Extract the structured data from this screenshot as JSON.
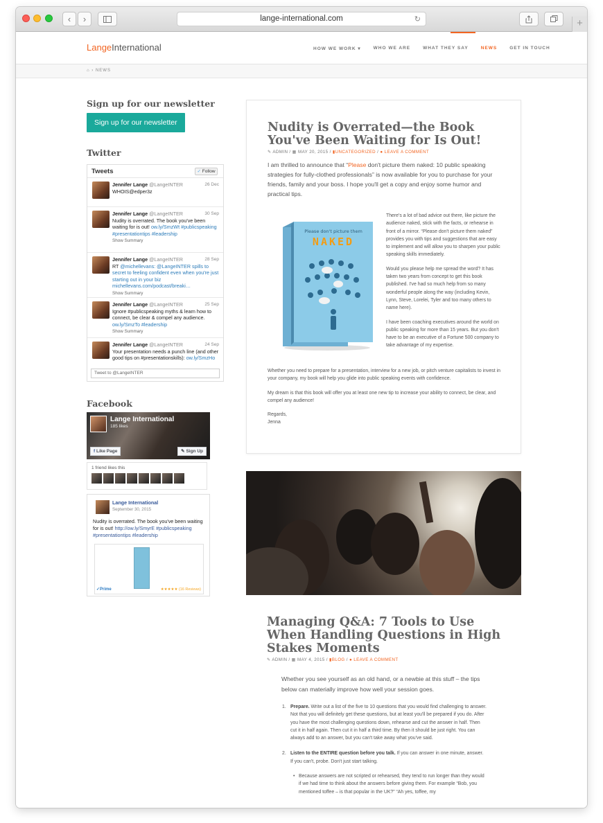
{
  "browser": {
    "url": "lange-international.com",
    "back": "‹",
    "forward": "›",
    "reload": "↻",
    "new_tab": "+"
  },
  "nav": {
    "logo_a": "Lange",
    "logo_b": "International",
    "items": [
      {
        "label": "HOW WE WORK ▾"
      },
      {
        "label": "WHO WE ARE"
      },
      {
        "label": "WHAT THEY SAY"
      },
      {
        "label": "NEWS"
      },
      {
        "label": "GET IN TOUCH"
      }
    ]
  },
  "breadcrumb": {
    "home_icon": "⌂",
    "separator": "›",
    "current": "NEWS"
  },
  "newsletter": {
    "heading": "Sign up for our newsletter",
    "button": "Sign up for our newsletter"
  },
  "twitter": {
    "heading": "Twitter",
    "tweets_label": "Tweets",
    "follow": "Follow",
    "tweets": [
      {
        "name": "Jennifer Lange",
        "handle": "@LangeINTER",
        "date": "26 Dec",
        "text": "WHOIS@edper3z",
        "summary": ""
      },
      {
        "name": "Jennifer Lange",
        "handle": "@LangeINTER",
        "date": "30 Sep",
        "text": "Nudity is overrated. The book you've been waiting for is out! ",
        "link": "ow.ly/SmzWt #publicspeaking #presentationtips #leadership",
        "summary": "Show Summary"
      },
      {
        "name": "Jennifer Lange",
        "handle": "@LangeINTER",
        "date": "28 Sep",
        "text": "RT ",
        "link": "@michellevans: @LangeINTER spills to secret to feeling confident even when you're just starting out in your biz michellevans.com/podcast/breaki…",
        "summary": "Show Summary"
      },
      {
        "name": "Jennifer Lange",
        "handle": "@LangeINTER",
        "date": "25 Sep",
        "text": "Ignore #publicspeaking myths & learn how to connect, be clear & compel any audience. ",
        "link": "ow.ly/SmzTo #leadership",
        "summary": "Show Summary"
      },
      {
        "name": "Jennifer Lange",
        "handle": "@LangeINTER",
        "date": "24 Sep",
        "text": "Your presentation needs a punch line (and other good tips on #presentationskills): ",
        "link": "ow.ly/SmzHo",
        "summary": ""
      }
    ],
    "compose_placeholder": "Tweet to @LangeINTER"
  },
  "facebook": {
    "heading": "Facebook",
    "page_name": "Lange International",
    "likes": "185 likes",
    "like_button": "Like Page",
    "signup_button": "Sign Up",
    "friends_text": "1 friend likes this",
    "post": {
      "author": "Lange International",
      "date": "September 30, 2015",
      "text": "Nudity is overrated. The book you've been waiting for is out! ",
      "link": "http://ow.ly/SmyrE #publicspeaking #presentationtips #leadership",
      "prime": "✓Prime",
      "stars": "★★★★★ (16 Reviews)"
    }
  },
  "post1": {
    "title": "Nudity is Overrated—the Book You've Been Waiting for Is Out!",
    "author": "ADMIN",
    "date": "MAY 20, 2015",
    "category": "UNCATEGORIZED",
    "comment": "LEAVE A COMMENT",
    "lead_a": "I am thrilled to announce that “",
    "lead_hl": "Please",
    "lead_b": " don't picture them naked: 10 public speaking strategies for fully-clothed professionals” is now available for you to purchase for your friends, family and your boss. I hope you'll get a copy and enjoy some humor and practical tips.",
    "book_title": "Please don't picture them",
    "book_big": "NAKED",
    "p1": "There's a lot of bad advice out there, like picture the audience naked, stick with the facts, or rehearse in front of a mirror. “Please don't picture them naked” provides you with tips and suggestions that are easy to implement and will allow you to sharpen your public speaking skills immediately.",
    "p2": "Would you please help me spread the word? It has taken two years from concept to get this book published. I've had so much help from so many wonderful people along the way (including Kevin, Lynn, Steve, Lorelei, Tyler and too many others to name here).",
    "p3": "I have been coaching executives around the world on public speaking for more than 15 years. But you don't have to be an executive of a Fortune 500 company to take advantage of my expertise.",
    "p3b": "Whether you need to prepare for a presentation, interview for a new job, or pitch venture capitalists to invest in your company, my book will help you glide into public speaking events with confidence.",
    "p4": "My dream is that this book will offer you at least one new tip to increase your ability to connect, be clear, and compel any audience!",
    "p5": "Regards,",
    "p6": "Jenna"
  },
  "post2": {
    "title": "Managing Q&A: 7 Tools to Use When Handling Questions in High Stakes Moments",
    "author": "ADMIN",
    "date": "MAY 4, 2015",
    "category": "BLOG",
    "comment": "LEAVE A COMMENT",
    "lead": "Whether you see yourself as an old hand, or a newbie at this stuff – the tips below can materially improve how well your session goes.",
    "items": [
      {
        "num": "1.",
        "bold": "Prepare.",
        "text": " Write out a list of the five to 10 questions that you would find challenging to answer. Not that you will definitely get these questions, but at least you'll be prepared if you do. After you have the most challenging questions down, rehearse and cut the answer in half. Then cut it in half again. Then cut it in half a third time. By then it should be just right. You can always add to an answer, but you can't take away what you've said."
      },
      {
        "num": "2.",
        "bold": "Listen to the ENTIRE question before you talk.",
        "text": " If you can answer in one minute, answer. If you can't, probe. Don't just start talking."
      }
    ],
    "bullet": "Because answers are not scripted or rehearsed, they tend to run longer than they would if we had time to think about the answers before giving them. For example “Bob, you mentioned toffee – is that popular in the UK?” “Ah yes, toffee, my"
  }
}
